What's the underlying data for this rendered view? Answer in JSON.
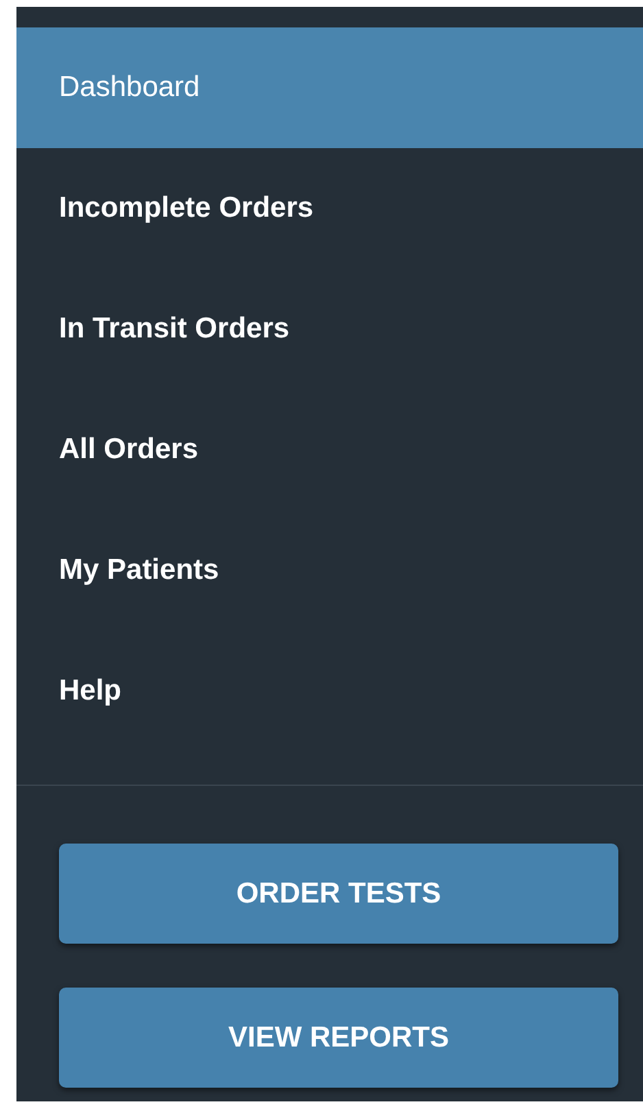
{
  "nav_items": [
    {
      "label": "Dashboard",
      "selected": true
    },
    {
      "label": "Incomplete Orders",
      "selected": false
    },
    {
      "label": "In Transit Orders",
      "selected": false
    },
    {
      "label": "All Orders",
      "selected": false
    },
    {
      "label": "My Patients",
      "selected": false
    },
    {
      "label": "Help",
      "selected": false
    }
  ],
  "buttons": [
    "ORDER TESTS",
    "VIEW REPORTS"
  ]
}
